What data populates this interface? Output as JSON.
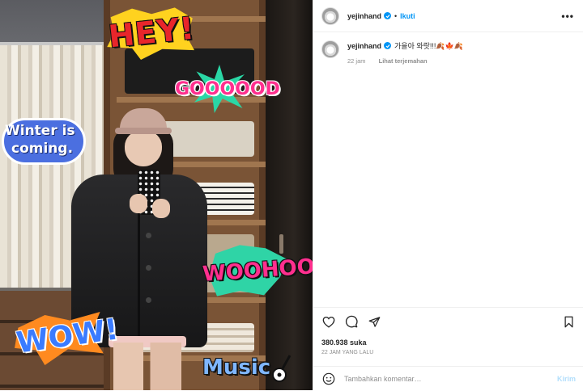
{
  "post": {
    "username": "yejinhand",
    "follow_label": "Ikuti",
    "separator": "•",
    "more_label": "•••",
    "caption": {
      "username": "yejinhand",
      "text": "가을아 와랏!!!🍂🍁🍂",
      "time": "22 jam",
      "translate_label": "Lihat terjemahan"
    },
    "likes": "380.938 suka",
    "posted": "22 jam yang lalu",
    "comment": {
      "placeholder": "Tambahkan komentar…",
      "send_label": "Kirim"
    }
  },
  "stickers": {
    "hey": "HEY!",
    "good": "GOOOOOD",
    "winter_line1": "Winter is",
    "winter_line2": "coming.",
    "woohoo": "WOOHOO",
    "wow": "WOW!",
    "music": "Music"
  },
  "icons": {
    "like": "heart-icon",
    "comment": "comment-icon",
    "share": "paper-plane-icon",
    "save": "bookmark-icon",
    "emoji": "smiley-icon",
    "verified": "verified-badge-icon"
  },
  "colors": {
    "accent": "#0095f6",
    "muted": "#8e8e8e",
    "send_disabled": "#b2dffc"
  }
}
